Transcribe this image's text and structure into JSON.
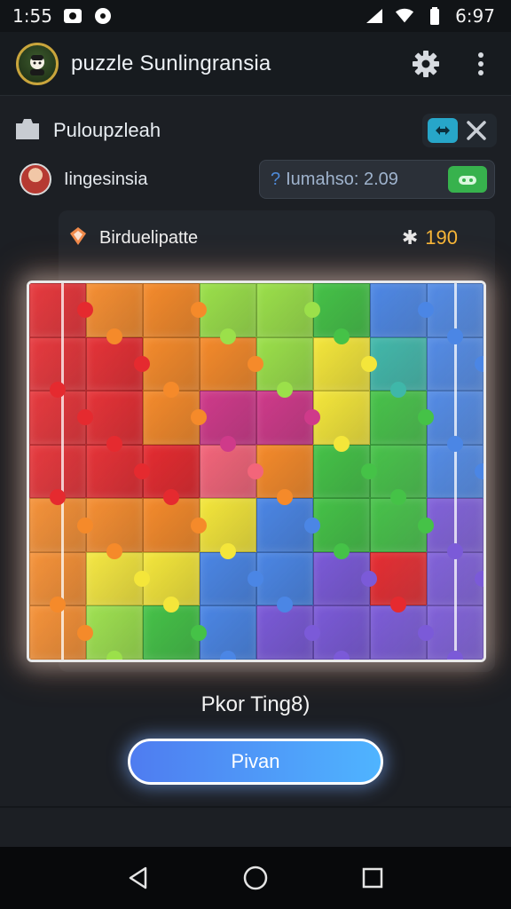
{
  "status_bar": {
    "time": "1:55",
    "battery": "6:97",
    "icons": [
      "photo-icon",
      "circle-app-icon",
      "signal-icon",
      "wifi-icon",
      "battery-icon"
    ]
  },
  "app_bar": {
    "title": "puzzle Sunlingransia",
    "icons": [
      "avatar-icon",
      "gear-icon",
      "more-vert-icon"
    ]
  },
  "row1": {
    "label": "Puloupzleah",
    "icons": [
      "folder-icon",
      "puzzle-chip-icon",
      "close-icon"
    ]
  },
  "row2": {
    "name": "Iingesinsia",
    "timer_prefix": "?",
    "timer_text": "Iumahso: 2.09"
  },
  "board": {
    "name": "Birduelipatte",
    "score": "190",
    "icons": [
      "puzzle-piece-icon",
      "star-icon"
    ],
    "colors": {
      "red": "#e52a2f",
      "orange": "#f58a2a",
      "yellow": "#f4e63a",
      "green": "#45c247",
      "lime": "#9be04a",
      "teal": "#3fb7a9",
      "blue": "#4b86e5",
      "purple": "#7b5ad8",
      "magenta": "#cf3a8a",
      "pink": "#f3657a"
    },
    "tiles": [
      [
        "red",
        "orange",
        "orange",
        "lime",
        "lime",
        "green",
        "blue",
        "blue"
      ],
      [
        "red",
        "red",
        "orange",
        "orange",
        "lime",
        "yellow",
        "teal",
        "blue"
      ],
      [
        "red",
        "red",
        "orange",
        "magenta",
        "magenta",
        "yellow",
        "green",
        "blue"
      ],
      [
        "red",
        "red",
        "red",
        "pink",
        "orange",
        "green",
        "green",
        "blue"
      ],
      [
        "orange",
        "orange",
        "orange",
        "yellow",
        "blue",
        "green",
        "green",
        "purple"
      ],
      [
        "orange",
        "yellow",
        "yellow",
        "blue",
        "blue",
        "purple",
        "red",
        "purple"
      ],
      [
        "orange",
        "lime",
        "green",
        "blue",
        "purple",
        "purple",
        "purple",
        "purple"
      ]
    ]
  },
  "status_text": "Pkor Ting8)",
  "play_button": "Pivan",
  "nav": [
    "back-icon",
    "home-icon",
    "recents-icon"
  ]
}
